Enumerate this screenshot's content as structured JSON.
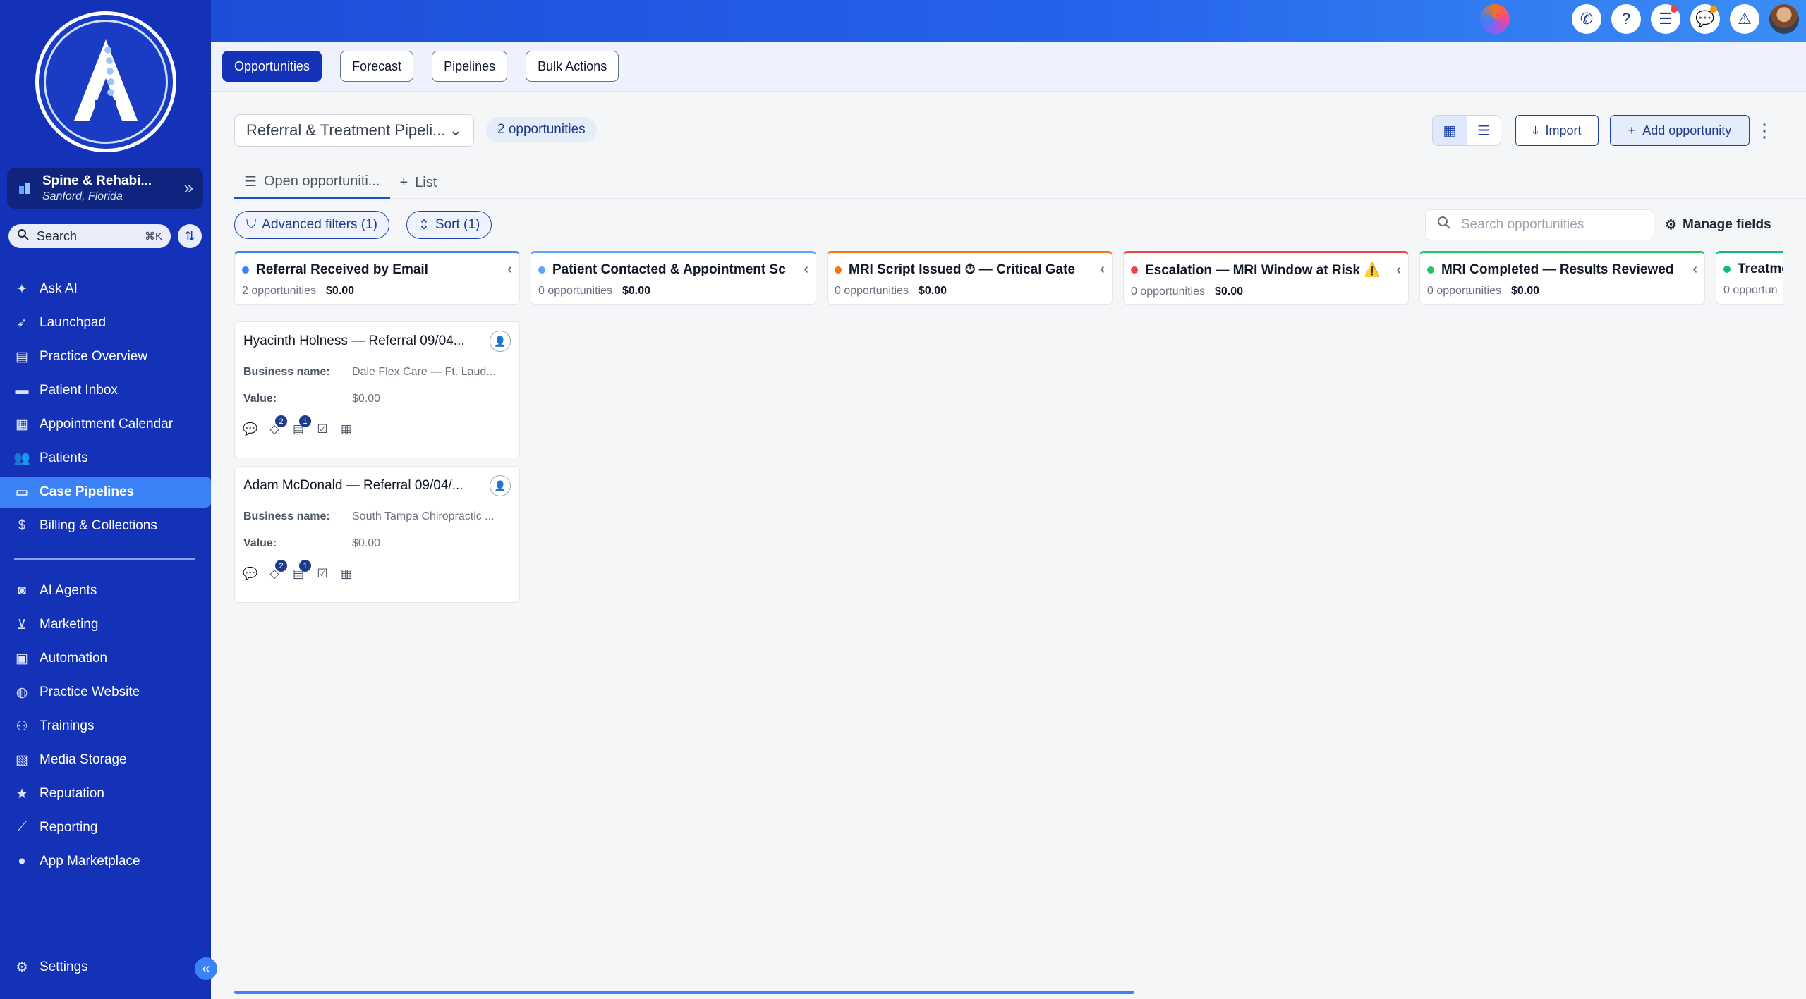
{
  "sidebar": {
    "location_name": "Spine & Rehabi...",
    "location_sub": "Sanford, Florida",
    "search_label": "Search",
    "search_shortcut": "⌘K",
    "items": [
      {
        "label": "Ask AI",
        "icon": "sparkle-icon"
      },
      {
        "label": "Launchpad",
        "icon": "rocket-icon"
      },
      {
        "label": "Practice Overview",
        "icon": "chart-icon"
      },
      {
        "label": "Patient Inbox",
        "icon": "chat-icon"
      },
      {
        "label": "Appointment Calendar",
        "icon": "calendar-icon"
      },
      {
        "label": "Patients",
        "icon": "users-icon"
      },
      {
        "label": "Case Pipelines",
        "icon": "pipeline-icon",
        "active": true
      },
      {
        "label": "Billing & Collections",
        "icon": "dollar-icon"
      }
    ],
    "items2": [
      {
        "label": "AI Agents",
        "icon": "robot-icon"
      },
      {
        "label": "Marketing",
        "icon": "cart-icon"
      },
      {
        "label": "Automation",
        "icon": "automation-icon"
      },
      {
        "label": "Practice Website",
        "icon": "globe-icon"
      },
      {
        "label": "Trainings",
        "icon": "group-icon"
      },
      {
        "label": "Media Storage",
        "icon": "image-icon"
      },
      {
        "label": "Reputation",
        "icon": "star-icon"
      },
      {
        "label": "Reporting",
        "icon": "line-chart-icon"
      },
      {
        "label": "App Marketplace",
        "icon": "apple-icon"
      }
    ],
    "settings_label": "Settings"
  },
  "tabs": [
    "Opportunities",
    "Forecast",
    "Pipelines",
    "Bulk Actions"
  ],
  "header": {
    "pipeline_name": "Referral & Treatment Pipeli...",
    "count_label": "2 opportunities",
    "import_label": "Import",
    "add_label": "Add opportunity"
  },
  "list_tabs": {
    "active": "Open opportuniti...",
    "add": "List"
  },
  "filters": {
    "advanced": "Advanced filters (1)",
    "sort": "Sort (1)",
    "search_placeholder": "Search opportunities",
    "manage": "Manage fields"
  },
  "columns": [
    {
      "title": "Referral Received by Email",
      "count": "2 opportunities",
      "value": "$0.00",
      "color": "#3b82f6"
    },
    {
      "title": "Patient Contacted & Appointment Sc",
      "count": "0 opportunities",
      "value": "$0.00",
      "color": "#60a5fa"
    },
    {
      "title": "MRI Script Issued ⏱ — Critical Gate",
      "count": "0 opportunities",
      "value": "$0.00",
      "color": "#f97316"
    },
    {
      "title": "Escalation — MRI Window at Risk ⚠️",
      "count": "0 opportunities",
      "value": "$0.00",
      "color": "#ef4444"
    },
    {
      "title": "MRI Completed — Results Reviewed",
      "count": "0 opportunities",
      "value": "$0.00",
      "color": "#22c55e"
    },
    {
      "title": "Treatme",
      "count": "0 opportun",
      "value": "",
      "color": "#10b981"
    }
  ],
  "cards": [
    {
      "title": "Hyacinth Holness — Referral 09/04...",
      "business_key": "Business name:",
      "business": "Dale Flex Care — Ft. Laud...",
      "value_key": "Value:",
      "value": "$0.00",
      "badge_a": "2",
      "badge_b": "1"
    },
    {
      "title": "Adam McDonald — Referral 09/04/...",
      "business_key": "Business name:",
      "business": "South Tampa Chiropractic ...",
      "value_key": "Value:",
      "value": "$0.00",
      "badge_a": "2",
      "badge_b": "1"
    }
  ]
}
